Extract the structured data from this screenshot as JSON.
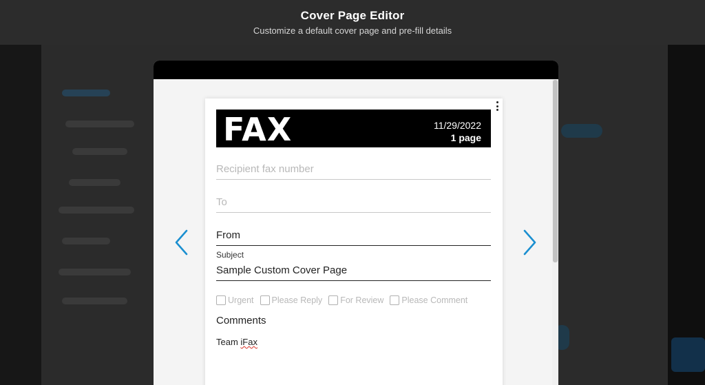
{
  "header": {
    "title": "Cover Page Editor",
    "subtitle": "Customize a default cover page and pre-fill details"
  },
  "cover": {
    "fax_word": "FAX",
    "date": "11/29/2022",
    "pages": "1 page",
    "recipient_placeholder": "Recipient fax number",
    "to_placeholder": "To",
    "from_value": "From",
    "subject_label": "Subject",
    "subject_value": "Sample Custom Cover Page",
    "checkboxes": [
      {
        "label": "Urgent"
      },
      {
        "label": "Please Reply"
      },
      {
        "label": "For Review"
      },
      {
        "label": "Please Comment"
      }
    ],
    "comments_label": "Comments",
    "comments_text_prefix": "Team ",
    "comments_text_spelled": "iFax"
  },
  "icons": {
    "prev": "chevron-left-icon",
    "next": "chevron-right-icon",
    "menu": "kebab-menu-icon"
  },
  "colors": {
    "accent": "#1a8fd0",
    "banner": "#000000",
    "overlay_header": "#2c2c2c"
  }
}
